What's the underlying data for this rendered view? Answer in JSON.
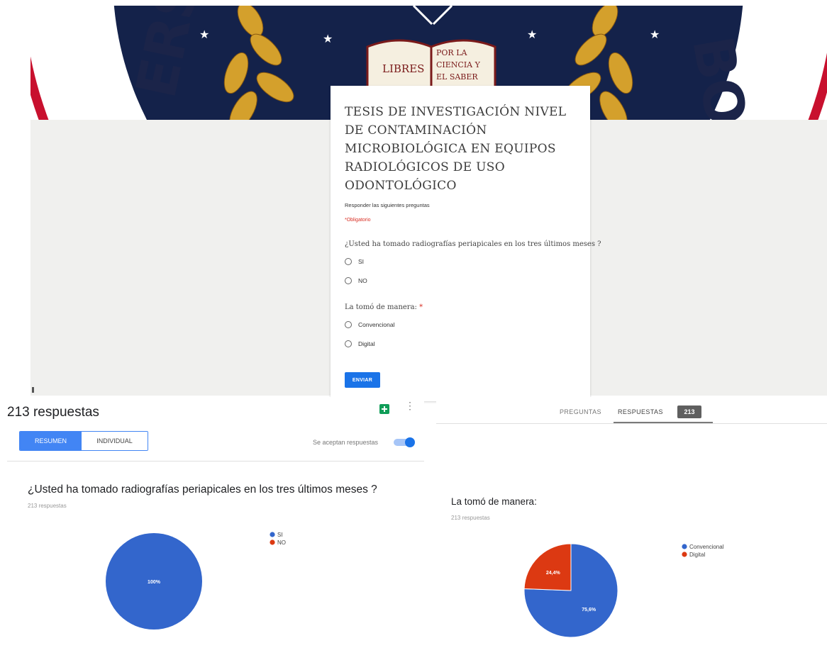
{
  "form": {
    "banner": {
      "book_left_text": "LIBRES",
      "book_right_lines": [
        "POR LA",
        "CIENCIA Y",
        "EL SABER"
      ],
      "ring_letters_left": "ERS",
      "ring_letters_right": "BO"
    },
    "title": "TESIS DE INVESTIGACIÓN NIVEL DE CONTAMINACIÓN MICROBIOLÓGICA EN EQUIPOS RADIOLÓGICOS DE USO ODONTOLÓGICO",
    "description": "Responder las siguientes preguntas",
    "required_note": "*Obligatorio",
    "questions": [
      {
        "text": "¿Usted ha tomado radiografías periapicales en los tres últimos meses ?",
        "required_mark": "",
        "options": [
          "SI",
          "NO"
        ]
      },
      {
        "text": "La tomó de manera:",
        "required_mark": "*",
        "options": [
          "Convencional",
          "Digital"
        ]
      }
    ],
    "submit_label": "ENVIAR"
  },
  "summary": {
    "header": "213 respuestas",
    "tab_summary": "RESUMEN",
    "tab_individual": "INDIVIDUAL",
    "accepting_label": "Se aceptan respuestas",
    "accepting_on": true,
    "question_title": "¿Usted ha tomado radiografías periapicales en los tres últimos meses ?",
    "question_sub": "213 respuestas"
  },
  "tabs": {
    "preguntas": "PREGUNTAS",
    "respuestas": "RESPUESTAS",
    "badge": "213",
    "question_title": "La tomó de manera:",
    "question_sub": "213 respuestas"
  },
  "colors": {
    "blue": "#3366cc",
    "red": "#dc3912",
    "accent": "#1a73e8",
    "navy": "#14224a"
  },
  "chart_data": [
    {
      "type": "pie",
      "title": "¿Usted ha tomado radiografías periapicales en los tres últimos meses ?",
      "subtitle": "213 respuestas",
      "categories": [
        "SI",
        "NO"
      ],
      "values": [
        100,
        0
      ],
      "labels": [
        "100%",
        ""
      ],
      "colors": [
        "#3366cc",
        "#dc3912"
      ],
      "legend": "right"
    },
    {
      "type": "pie",
      "title": "La tomó de manera:",
      "subtitle": "213 respuestas",
      "categories": [
        "Convencional",
        "Digital"
      ],
      "values": [
        75.6,
        24.4
      ],
      "labels": [
        "75,6%",
        "24,4%"
      ],
      "colors": [
        "#3366cc",
        "#dc3912"
      ],
      "legend": "right"
    }
  ]
}
